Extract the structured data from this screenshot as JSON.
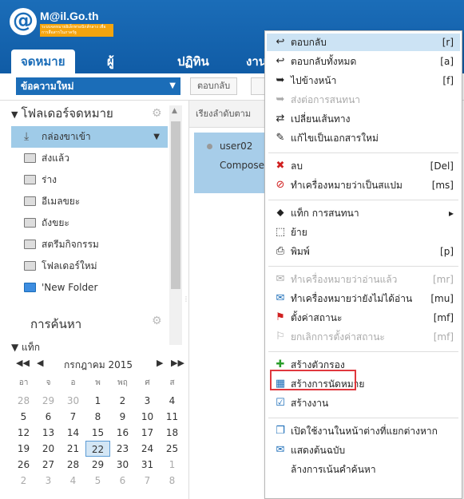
{
  "brand": {
    "name": "M@il.Go.th",
    "at": "@",
    "tagline": "ระบบจดหมายอิเล็กทรอนิกส์กลาง เพื่อการสื่อสารในภาครัฐ"
  },
  "tabs": [
    {
      "label": "จดหมาย",
      "active": true
    },
    {
      "label": "ผู้ติดต่อ",
      "active": false
    },
    {
      "label": "ปฏิทิน",
      "active": false
    },
    {
      "label": "งาน",
      "active": false
    }
  ],
  "toolbar": {
    "compose": "ข้อความใหม่",
    "reply": "ตอบกลับ"
  },
  "folders": {
    "heading": "โฟลเดอร์จดหมาย",
    "items": [
      {
        "label": "กล่องขาเข้า",
        "selected": true
      },
      {
        "label": "ส่งแล้ว"
      },
      {
        "label": "ร่าง"
      },
      {
        "label": "อีเมลขยะ"
      },
      {
        "label": "ถังขยะ"
      },
      {
        "label": "สตรีมกิจกรรม"
      },
      {
        "label": "โฟลเดอร์ใหม่"
      },
      {
        "label": "'New Folder"
      }
    ],
    "search_heading": "การค้นหา",
    "tags_heading": "แท็ก"
  },
  "calendar": {
    "month": "กรกฎาคม 2015",
    "dow": [
      "อา",
      "จ",
      "อ",
      "พ",
      "พฤ",
      "ศ",
      "ส"
    ],
    "weeks": [
      [
        "28",
        "29",
        "30",
        "1",
        "2",
        "3",
        "4"
      ],
      [
        "5",
        "6",
        "7",
        "8",
        "9",
        "10",
        "11"
      ],
      [
        "12",
        "13",
        "14",
        "15",
        "16",
        "17",
        "18"
      ],
      [
        "19",
        "20",
        "21",
        "22",
        "23",
        "24",
        "25"
      ],
      [
        "26",
        "27",
        "28",
        "29",
        "30",
        "31",
        "1"
      ],
      [
        "2",
        "3",
        "4",
        "5",
        "6",
        "7",
        "8"
      ]
    ],
    "today": "22"
  },
  "list": {
    "sort_label": "เรียงลำดับตาม",
    "message": {
      "from": "user02",
      "subject": "Compose"
    }
  },
  "menu": [
    {
      "label": "ตอบกลับ",
      "key": "[r]",
      "icon": "reply-icon",
      "glyph": "↩",
      "hl": true
    },
    {
      "label": "ตอบกลับทั้งหมด",
      "key": "[a]",
      "icon": "reply-all-icon",
      "glyph": "↩"
    },
    {
      "label": "ไปข้างหน้า",
      "key": "[f]",
      "icon": "forward-icon",
      "glyph": "➥"
    },
    {
      "label": "ส่งต่อการสนทนา",
      "key": "",
      "icon": "forward-conversation-icon",
      "glyph": "➥",
      "disabled": true
    },
    {
      "label": "เปลี่ยนเส้นทาง",
      "key": "",
      "icon": "redirect-icon",
      "glyph": "⇄"
    },
    {
      "label": "แก้ไขเป็นเอกสารใหม่",
      "key": "",
      "icon": "edit-pencil-icon",
      "glyph": "✎"
    },
    {
      "sep": true
    },
    {
      "label": "ลบ",
      "key": "[Del]",
      "icon": "delete-x-icon",
      "glyph": "✖",
      "color": "#d02020"
    },
    {
      "label": "ทำเครื่องหมายว่าเป็นสแปม",
      "key": "[ms]",
      "icon": "spam-icon",
      "glyph": "⊘",
      "color": "#d02020"
    },
    {
      "sep": true
    },
    {
      "label": "แท็ก การสนทนา",
      "key": "▸",
      "icon": "tag-icon",
      "glyph": "⬥"
    },
    {
      "label": "ย้าย",
      "key": "",
      "icon": "move-icon",
      "glyph": "⬚"
    },
    {
      "label": "พิมพ์",
      "key": "[p]",
      "icon": "print-icon",
      "glyph": "⎙"
    },
    {
      "sep": true
    },
    {
      "label": "ทำเครื่องหมายว่าอ่านแล้ว",
      "key": "[mr]",
      "icon": "mark-read-icon",
      "glyph": "✉",
      "disabled": true
    },
    {
      "label": "ทำเครื่องหมายว่ายังไม่ได้อ่าน",
      "key": "[mu]",
      "icon": "mark-unread-icon",
      "glyph": "✉",
      "color": "#1b6db8"
    },
    {
      "label": "ตั้งค่าสถานะ",
      "key": "[mf]",
      "icon": "flag-icon",
      "glyph": "⚑",
      "color": "#d02020"
    },
    {
      "label": "ยกเลิกการตั้งค่าสถานะ",
      "key": "[mf]",
      "icon": "unflag-icon",
      "glyph": "⚐",
      "disabled": true
    },
    {
      "sep": true
    },
    {
      "label": "สร้างตัวกรอง",
      "key": "",
      "icon": "add-filter-icon",
      "glyph": "✚",
      "color": "#2a9d2a"
    },
    {
      "label": "สร้างการนัดหมาย",
      "key": "",
      "icon": "calendar-icon",
      "glyph": "▦",
      "color": "#1b6db8"
    },
    {
      "label": "สร้างงาน",
      "key": "",
      "icon": "task-check-icon",
      "glyph": "☑",
      "color": "#1b6db8"
    },
    {
      "sep": true
    },
    {
      "label": "เปิดใช้งานในหน้าต่างที่แยกต่างหาก",
      "key": "",
      "icon": "new-window-icon",
      "glyph": "❐",
      "color": "#1b6db8"
    },
    {
      "label": "แสดงต้นฉบับ",
      "key": "",
      "icon": "show-original-icon",
      "glyph": "✉",
      "color": "#1b6db8"
    },
    {
      "label": "ล้างการเน้นคำค้นหา",
      "key": "",
      "icon": "",
      "glyph": ""
    }
  ]
}
